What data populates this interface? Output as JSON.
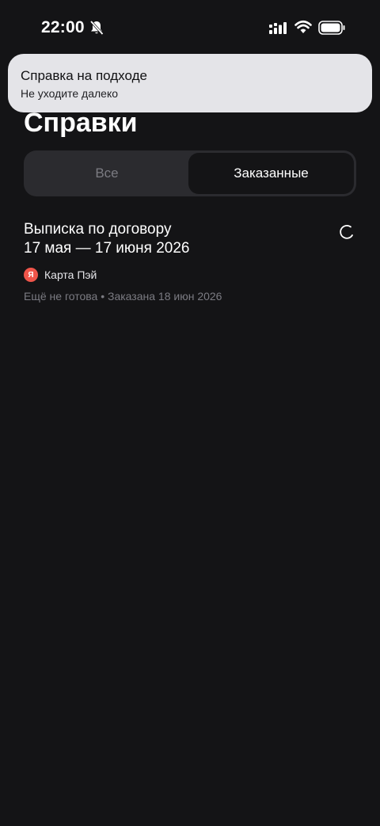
{
  "status_bar": {
    "time": "22:00",
    "icons": [
      "bell-muted-icon",
      "cellular-signal-icon",
      "wifi-icon",
      "battery-icon"
    ]
  },
  "toast": {
    "title": "Справка на подходе",
    "subtitle": "Не уходите далеко"
  },
  "page": {
    "title": "Справки"
  },
  "tabs": [
    {
      "label": "Все",
      "selected": false
    },
    {
      "label": "Заказанные",
      "selected": true
    }
  ],
  "items": [
    {
      "title_line1": "Выписка по договору",
      "title_line2": "17 мая — 17 июня 2026",
      "source_logo": "Я",
      "source_name": "Карта Пэй",
      "status": "Ещё не готова • Заказана 18 июн 2026",
      "loading_icon": "spinner-icon"
    }
  ],
  "colors": {
    "background": "#141416",
    "toast_background": "#e4e4e8",
    "segment_background": "#2b2b2f",
    "secondary_text": "#7b7b82",
    "brand_red": "#f0554a"
  }
}
